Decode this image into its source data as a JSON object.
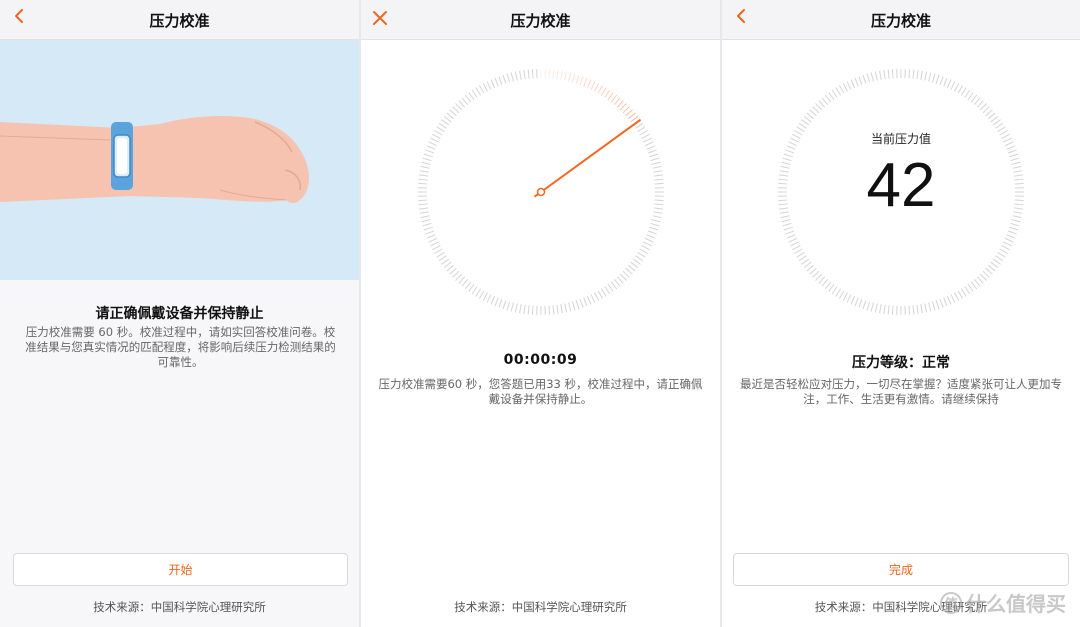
{
  "colors": {
    "accent": "#f0661e",
    "hero_bg": "#d6e9f6",
    "band": "#5aa3dc"
  },
  "panel1": {
    "title": "压力校准",
    "back_icon": "chevron-left-icon",
    "heading": "请正确佩戴设备并保持静止",
    "desc_lines": [
      "压力校准需要 60 秒。校准过程中，请如实回答校准问卷。校",
      "准结果与您真实情况的匹配程度，将影响后续压力检测结果的",
      "可靠性。"
    ],
    "button": "开始",
    "footer": "技术来源：中国科学院心理研究所"
  },
  "panel2": {
    "title": "压力校准",
    "close_icon": "close-icon",
    "dial_progress": 0.15,
    "timer": "00:00:09",
    "desc_lines": [
      "压力校准需要60 秒，您答题已用33 秒，校准过程中，请正确佩",
      "戴设备并保持静止。"
    ],
    "footer": "技术来源：中国科学院心理研究所"
  },
  "panel3": {
    "title": "压力校准",
    "back_icon": "chevron-left-icon",
    "value_label": "当前压力值",
    "value": "42",
    "level": "压力等级：正常",
    "desc_lines": [
      "最近是否轻松应对压力，一切尽在掌握？适度紧张可让人更加专",
      "注，工作、生活更有激情。请继续保持"
    ],
    "button": "完成",
    "footer": "技术来源：中国科学院心理研究所"
  },
  "watermark": {
    "text": "什么值得买",
    "mark": "值"
  }
}
